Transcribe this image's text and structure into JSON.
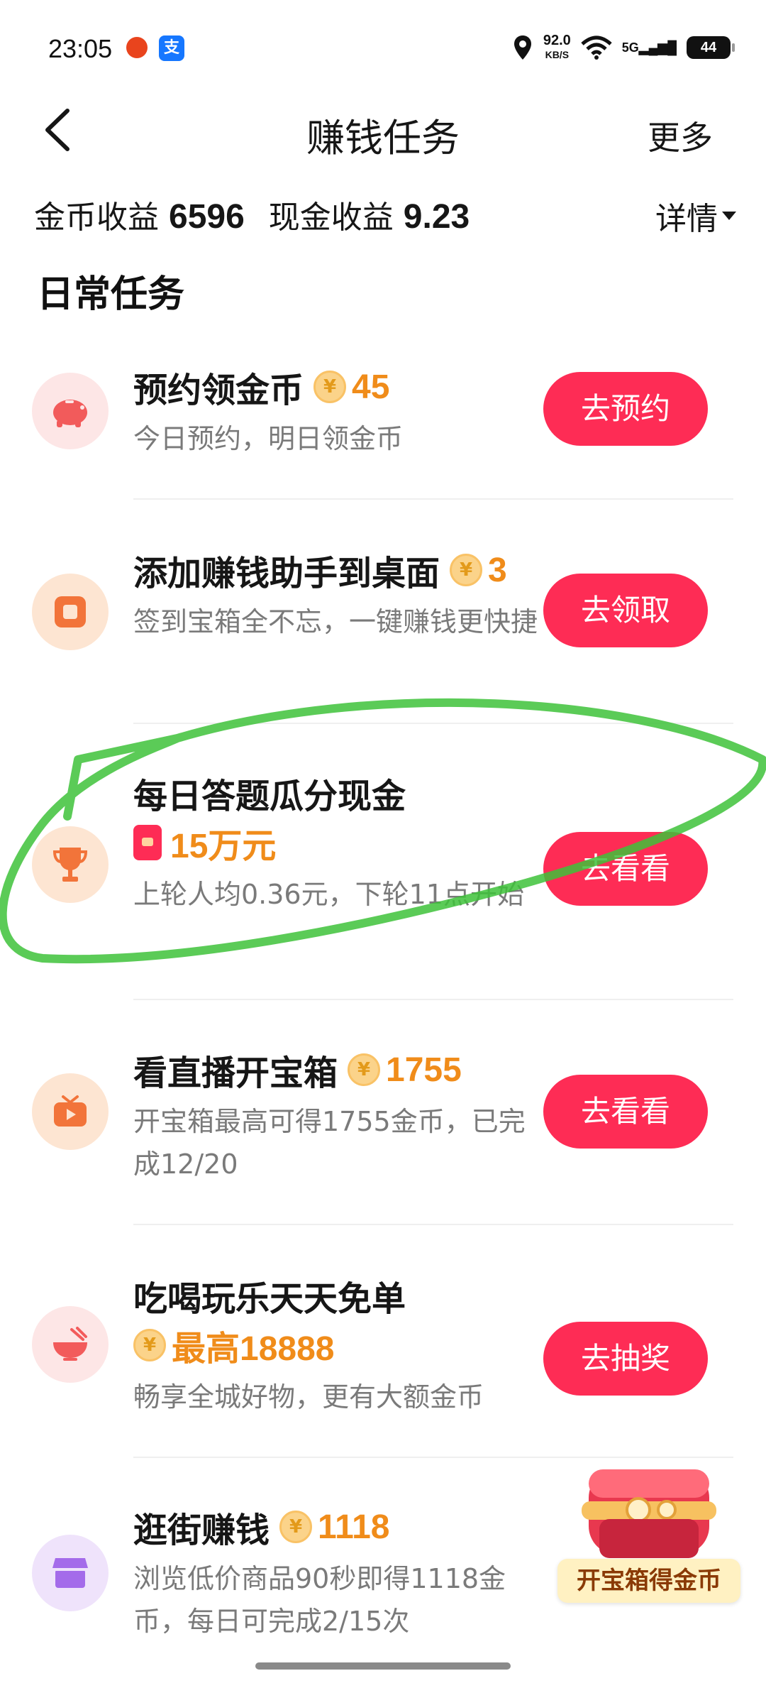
{
  "status_bar": {
    "time": "23:05",
    "net_speed": "92.0",
    "net_unit": "KB/S",
    "signal": "5G",
    "battery": "44"
  },
  "nav": {
    "title": "赚钱任务",
    "more": "更多"
  },
  "earnings": {
    "coin_label": "金币收益",
    "coin_value": "6596",
    "cash_label": "现金收益",
    "cash_value": "9.23",
    "details": "详情"
  },
  "section_title": "日常任务",
  "tasks": [
    {
      "title": "预约领金币",
      "reward": "45",
      "desc": "今日预约，明日领金币",
      "button": "去预约",
      "icon": "piggy-bank-icon"
    },
    {
      "title": "添加赚钱助手到桌面",
      "reward": "3",
      "desc": "签到宝箱全不忘，一键赚钱更快捷",
      "button": "去领取",
      "icon": "desktop-widget-icon"
    },
    {
      "title": "每日答题瓜分现金",
      "reward": "15万元",
      "desc": "上轮人均0.36元，下轮11点开始",
      "button": "去看看",
      "icon": "trophy-icon"
    },
    {
      "title": "看直播开宝箱",
      "reward": "1755",
      "desc": "开宝箱最高可得1755金币，已完成12/20",
      "button": "去看看",
      "icon": "tv-icon"
    },
    {
      "title": "吃喝玩乐天天免单",
      "reward": "最高18888",
      "desc": "畅享全城好物，更有大额金币",
      "button": "去抽奖",
      "icon": "bowl-icon"
    },
    {
      "title": "逛街赚钱",
      "reward": "1118",
      "desc": "浏览低价商品90秒即得1118金币，每日可完成2/15次",
      "button": "",
      "icon": "shop-icon"
    }
  ],
  "coin_symbol": "¥",
  "chest": {
    "label": "开宝箱得金币"
  },
  "colors": {
    "accent": "#fe2c55",
    "reward": "#f08c1a",
    "annotation": "#3ec23a"
  }
}
